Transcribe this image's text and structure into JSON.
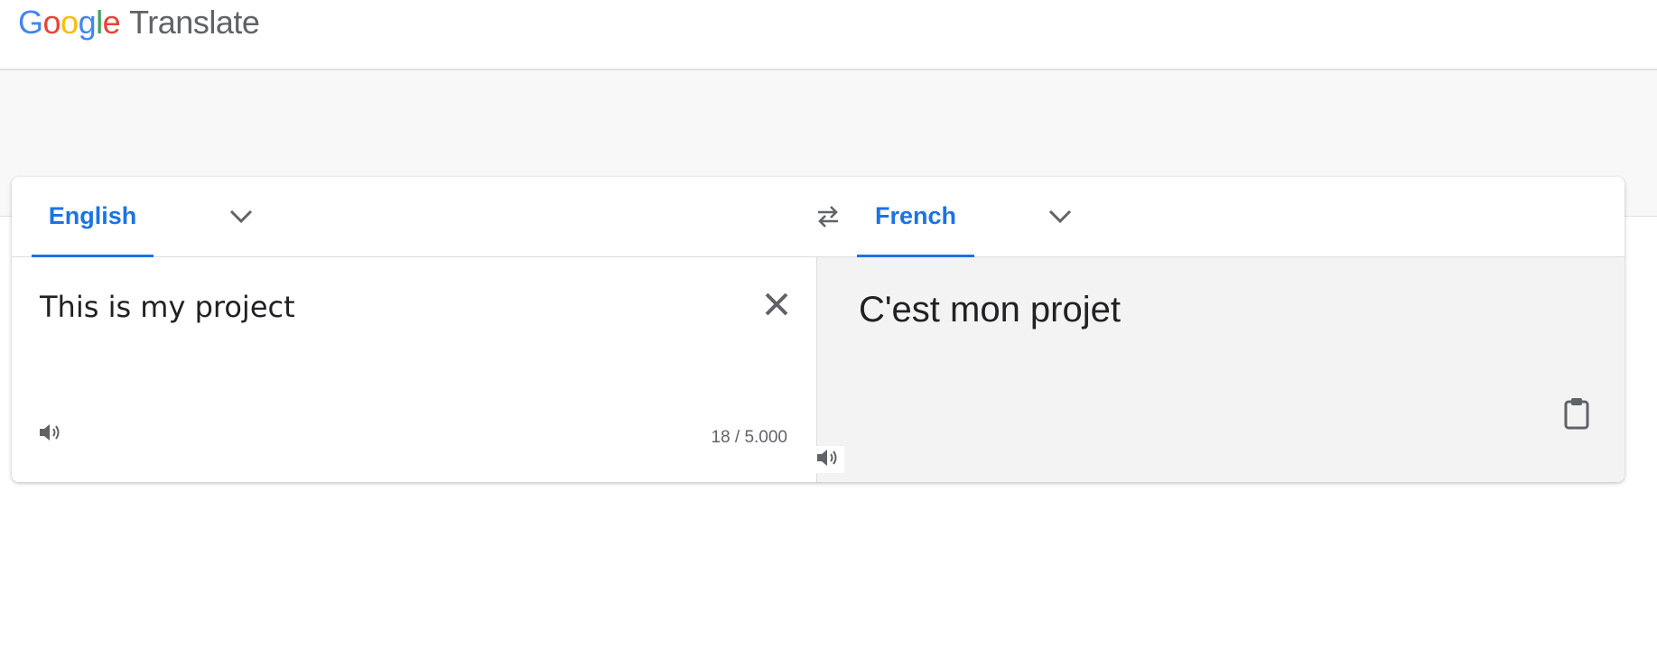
{
  "app": {
    "logo_letters": [
      {
        "char": "G",
        "color": "#4285f4"
      },
      {
        "char": "o",
        "color": "#ea4335"
      },
      {
        "char": "o",
        "color": "#fbbc05"
      },
      {
        "char": "g",
        "color": "#4285f4"
      },
      {
        "char": "l",
        "color": "#34a853"
      },
      {
        "char": "e",
        "color": "#ea4335"
      }
    ],
    "product_name": "Translate"
  },
  "source": {
    "language": "English",
    "text": "This is my project",
    "char_count": "18 / 5.000"
  },
  "target": {
    "language": "French",
    "text": "C'est mon projet"
  },
  "icons": {
    "source_chevron": "chevron-down-icon",
    "target_chevron": "chevron-down-icon",
    "swap": "swap-icon",
    "clear": "close-icon",
    "source_listen": "speaker-icon",
    "target_listen": "speaker-icon",
    "copy": "clipboard-icon"
  },
  "colors": {
    "accent": "#1a73e8",
    "icon": "#5f6368",
    "target_pane_bg": "#f3f3f3"
  }
}
